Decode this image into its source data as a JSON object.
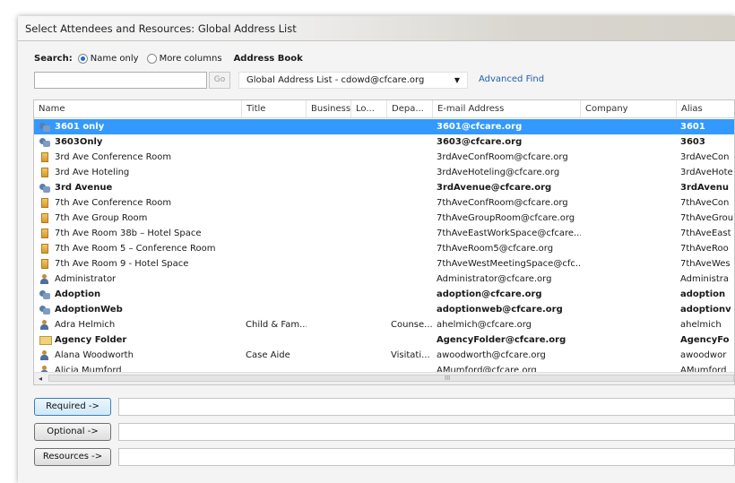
{
  "dialog": {
    "title": "Select Attendees and Resources: Global Address List"
  },
  "search": {
    "label": "Search:",
    "option_name_only": "Name only",
    "option_more_columns": "More columns",
    "selected_option": "Name only",
    "input_value": "",
    "go_label": "Go"
  },
  "address_book": {
    "label": "Address Book",
    "selected": "Global Address List - cdowd@cfcare.org",
    "advanced_find": "Advanced Find"
  },
  "columns": [
    "Name",
    "Title",
    "Business...",
    "Lo...",
    "Depa...",
    "E-mail Address",
    "Company",
    "Alias"
  ],
  "rows": [
    {
      "icon": "distribution-list-icon",
      "name": "3601 only",
      "title": "",
      "business": "",
      "location": "",
      "department": "",
      "email": "3601@cfcare.org",
      "company": "",
      "alias": "3601",
      "bold": true,
      "selected": true
    },
    {
      "icon": "distribution-list-icon",
      "name": "3603Only",
      "title": "",
      "business": "",
      "location": "",
      "department": "",
      "email": "3603@cfcare.org",
      "company": "",
      "alias": "3603",
      "bold": true,
      "selected": false
    },
    {
      "icon": "room-icon",
      "name": "3rd Ave Conference Room",
      "title": "",
      "business": "",
      "location": "",
      "department": "",
      "email": "3rdAveConfRoom@cfcare.org",
      "company": "",
      "alias": "3rdAveCon",
      "bold": false,
      "selected": false
    },
    {
      "icon": "room-icon",
      "name": "3rd Ave Hoteling",
      "title": "",
      "business": "",
      "location": "",
      "department": "",
      "email": "3rdAveHoteling@cfcare.org",
      "company": "",
      "alias": "3rdAveHote",
      "bold": false,
      "selected": false
    },
    {
      "icon": "distribution-list-icon",
      "name": "3rd Avenue",
      "title": "",
      "business": "",
      "location": "",
      "department": "",
      "email": "3rdAvenue@cfcare.org",
      "company": "",
      "alias": "3rdAvenu",
      "bold": true,
      "selected": false
    },
    {
      "icon": "room-icon",
      "name": "7th Ave Conference Room",
      "title": "",
      "business": "",
      "location": "",
      "department": "",
      "email": "7thAveConfRoom@cfcare.org",
      "company": "",
      "alias": "7thAveCon",
      "bold": false,
      "selected": false
    },
    {
      "icon": "room-icon",
      "name": "7th Ave Group Room",
      "title": "",
      "business": "",
      "location": "",
      "department": "",
      "email": "7thAveGroupRoom@cfcare.org",
      "company": "",
      "alias": "7thAveGrou",
      "bold": false,
      "selected": false
    },
    {
      "icon": "room-icon",
      "name": "7th Ave Room 38b – Hotel Space",
      "title": "",
      "business": "",
      "location": "",
      "department": "",
      "email": "7thAveEastWorkSpace@cfcare....",
      "company": "",
      "alias": "7thAveEast",
      "bold": false,
      "selected": false
    },
    {
      "icon": "room-icon",
      "name": "7th Ave Room 5 – Conference Room",
      "title": "",
      "business": "",
      "location": "",
      "department": "",
      "email": "7thAveRoom5@cfcare.org",
      "company": "",
      "alias": "7thAveRoo",
      "bold": false,
      "selected": false
    },
    {
      "icon": "room-icon",
      "name": "7th Ave Room 9 - Hotel Space",
      "title": "",
      "business": "",
      "location": "",
      "department": "",
      "email": "7thAveWestMeetingSpace@cfc...",
      "company": "",
      "alias": "7thAveWes",
      "bold": false,
      "selected": false
    },
    {
      "icon": "user-icon",
      "name": "Administrator",
      "title": "",
      "business": "",
      "location": "",
      "department": "",
      "email": "Administrator@cfcare.org",
      "company": "",
      "alias": "Administra",
      "bold": false,
      "selected": false
    },
    {
      "icon": "distribution-list-icon",
      "name": "Adoption",
      "title": "",
      "business": "",
      "location": "",
      "department": "",
      "email": "adoption@cfcare.org",
      "company": "",
      "alias": "adoption",
      "bold": true,
      "selected": false
    },
    {
      "icon": "distribution-list-icon",
      "name": "AdoptionWeb",
      "title": "",
      "business": "",
      "location": "",
      "department": "",
      "email": "adoptionweb@cfcare.org",
      "company": "",
      "alias": "adoptionv",
      "bold": true,
      "selected": false
    },
    {
      "icon": "user-icon",
      "name": "Adra Helmich",
      "title": "Child & Fam...",
      "business": "",
      "location": "",
      "department": "Counse...",
      "email": "ahelmich@cfcare.org",
      "company": "",
      "alias": "ahelmich",
      "bold": false,
      "selected": false
    },
    {
      "icon": "folder-icon",
      "name": "Agency Folder",
      "title": "",
      "business": "",
      "location": "",
      "department": "",
      "email": "AgencyFolder@cfcare.org",
      "company": "",
      "alias": "AgencyFo",
      "bold": true,
      "selected": false
    },
    {
      "icon": "user-icon",
      "name": "Alana Woodworth",
      "title": "Case Aide",
      "business": "",
      "location": "",
      "department": "Visitati...",
      "email": "awoodworth@cfcare.org",
      "company": "",
      "alias": "awoodwor",
      "bold": false,
      "selected": false
    },
    {
      "icon": "user-icon",
      "name": "Alicia Mumford",
      "title": "",
      "business": "",
      "location": "",
      "department": "",
      "email": "AMumford@cfcare.org",
      "company": "",
      "alias": "AMumford",
      "bold": false,
      "selected": false
    }
  ],
  "scrollbar": {
    "left_arrow": "◂",
    "grip": "III"
  },
  "recipients": {
    "required_label": "Required ->",
    "required_value": "",
    "optional_label": "Optional ->",
    "optional_value": "",
    "resources_label": "Resources ->",
    "resources_value": ""
  },
  "colors": {
    "selection": "#3399ff",
    "link": "#1f5fae"
  }
}
